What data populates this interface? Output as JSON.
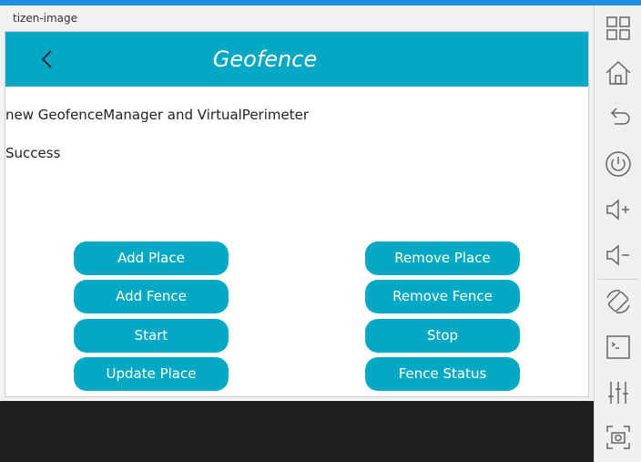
{
  "window": {
    "title": "tizen-image"
  },
  "app": {
    "title": "Geofence",
    "messages": [
      "new GeofenceManager and VirtualPerimeter",
      "Success"
    ],
    "buttons": {
      "add_place": "Add Place",
      "remove_place": "Remove Place",
      "add_fence": "Add Fence",
      "remove_fence": "Remove Fence",
      "start": "Start",
      "stop": "Stop",
      "update_place": "Update Place",
      "fence_status": "Fence Status"
    },
    "accent_color": "#03a9c4"
  },
  "sidebar_icons": [
    "apps-icon",
    "home-icon",
    "back-icon",
    "power-icon",
    "volume-up-icon",
    "volume-down-icon",
    "rotate-icon",
    "terminal-icon",
    "settings-sliders-icon",
    "screenshot-icon"
  ]
}
